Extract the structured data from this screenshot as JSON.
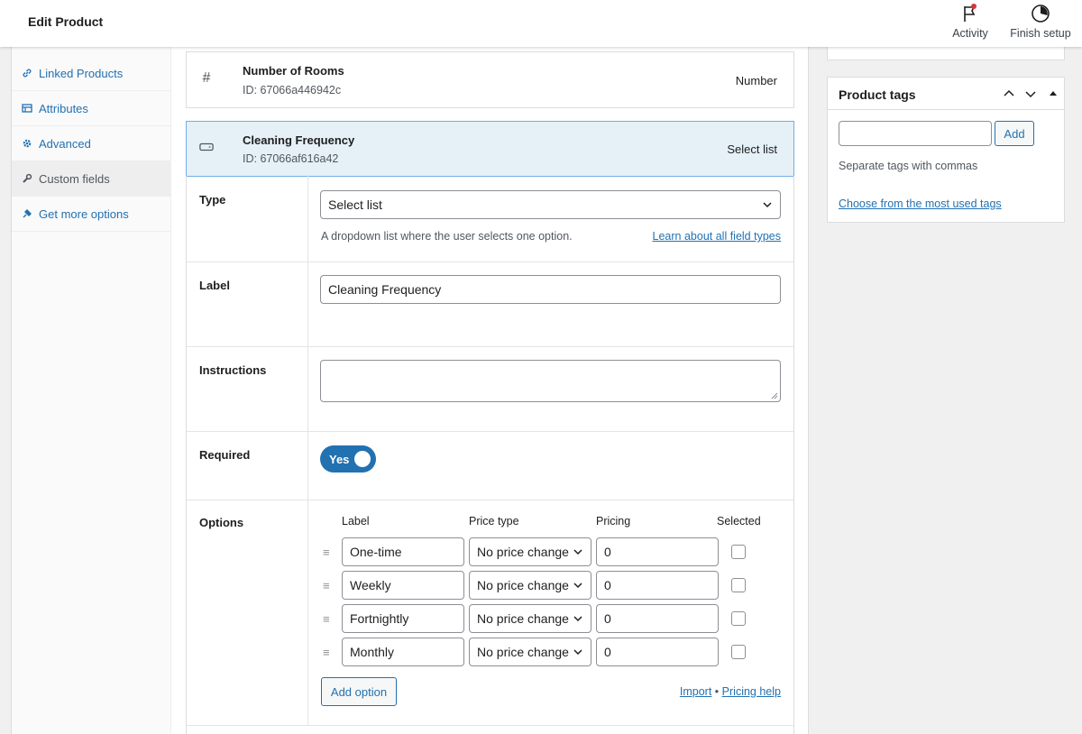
{
  "header": {
    "title": "Edit Product",
    "activity_label": "Activity",
    "finish_setup_label": "Finish setup"
  },
  "tabs": [
    {
      "label": "Linked Products",
      "icon": "link-icon"
    },
    {
      "label": "Attributes",
      "icon": "table-icon"
    },
    {
      "label": "Advanced",
      "icon": "gear-icon"
    },
    {
      "label": "Custom fields",
      "icon": "wrench-icon",
      "active": true
    },
    {
      "label": "Get more options",
      "icon": "plugin-icon"
    }
  ],
  "fields": [
    {
      "name": "Number of Rooms",
      "id": "ID: 67066a446942c",
      "type": "Number",
      "icon": "hash-icon"
    },
    {
      "name": "Cleaning Frequency",
      "id": "ID: 67066af616a42",
      "type": "Select list",
      "icon": "select-list-icon"
    }
  ],
  "settings": {
    "type": {
      "label": "Type",
      "value": "Select list",
      "description": "A dropdown list where the user selects one option.",
      "link": "Learn about all field types"
    },
    "label": {
      "label": "Label",
      "value": "Cleaning Frequency"
    },
    "instructions": {
      "label": "Instructions",
      "value": ""
    },
    "required": {
      "label": "Required",
      "toggle_label": "Yes",
      "on": true
    },
    "options": {
      "label": "Options",
      "headers": {
        "label": "Label",
        "price_type": "Price type",
        "pricing": "Pricing",
        "selected": "Selected"
      },
      "rows": [
        {
          "label": "One-time",
          "price_type": "No price change",
          "pricing": "0",
          "selected": false
        },
        {
          "label": "Weekly",
          "price_type": "No price change",
          "pricing": "0",
          "selected": false
        },
        {
          "label": "Fortnightly",
          "price_type": "No price change",
          "pricing": "0",
          "selected": false
        },
        {
          "label": "Monthly",
          "price_type": "No price change",
          "pricing": "0",
          "selected": false
        }
      ],
      "add_option": "Add option",
      "import": "Import",
      "separator": "•",
      "pricing_help": "Pricing help"
    }
  },
  "product_tags": {
    "title": "Product tags",
    "input_value": "",
    "add_label": "Add",
    "hint": "Separate tags with commas",
    "most_used_link": "Choose from the most used tags"
  },
  "colors": {
    "accent": "#2271b1",
    "selected_row_bg": "#e6f0f7",
    "notification_dot": "#d63638"
  }
}
